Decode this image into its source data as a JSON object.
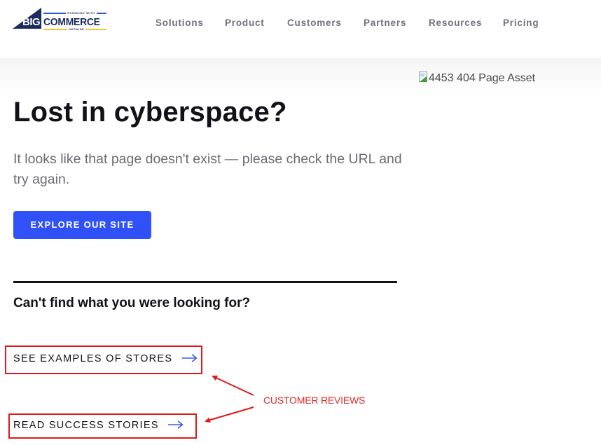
{
  "header": {
    "logo": {
      "big": "BIG",
      "commerce": "COMMERCE",
      "tagline_top": "STANDING WITH",
      "tagline_bottom": "UKRAINE"
    },
    "nav": [
      {
        "label": "Solutions"
      },
      {
        "label": "Product"
      },
      {
        "label": "Customers"
      },
      {
        "label": "Partners"
      },
      {
        "label": "Resources"
      },
      {
        "label": "Pricing"
      }
    ]
  },
  "hero": {
    "image_alt": "4453 404 Page Asset",
    "title": "Lost in cyberspace?",
    "subtitle": "It looks like that page doesn't exist — please check the URL and try again.",
    "cta_label": "EXPLORE OUR SITE",
    "cta_color": "#3050f8"
  },
  "help": {
    "heading": "Can't find what you were looking for?",
    "links": [
      {
        "label": "SEE EXAMPLES OF STORES",
        "icon": "arrow-right-icon"
      },
      {
        "label": "READ SUCCESS STORIES",
        "icon": "arrow-right-icon"
      }
    ]
  },
  "annotation": {
    "label": "CUSTOMER REVIEWS",
    "color": "#e01919"
  }
}
